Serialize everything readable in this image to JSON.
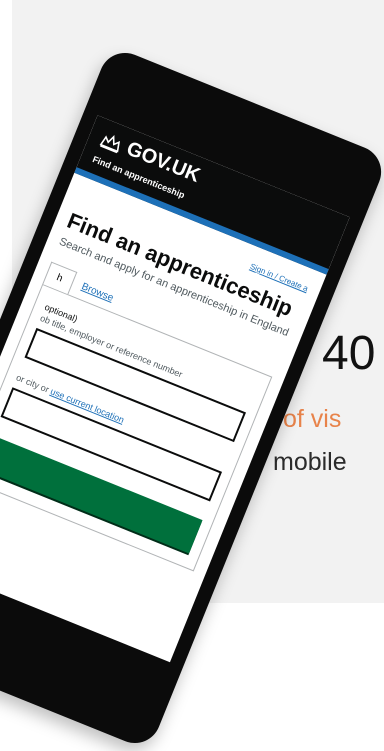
{
  "stat": {
    "figure": "40",
    "line1": "of vis",
    "line2": "mobile"
  },
  "phone": {
    "header": {
      "logo_text": "GOV.UK",
      "service_name": "Find an apprenticeship"
    },
    "signin_text": "Sign in / Create a",
    "page_title": "Find an apprenticeship",
    "subtitle": "Search and apply for an apprenticeship in England",
    "tabs": [
      {
        "label": "h"
      },
      {
        "label": "Browse"
      }
    ],
    "keyword_label": "optional)",
    "keyword_hint": "ob title, employer or reference number",
    "location_hint_prefix": "or city or ",
    "location_link": "use current location"
  },
  "colors": {
    "gov_black": "#0b0c0c",
    "gov_blue": "#1d70b8",
    "gov_green": "#00703c",
    "stat_orange": "#e8834a"
  }
}
